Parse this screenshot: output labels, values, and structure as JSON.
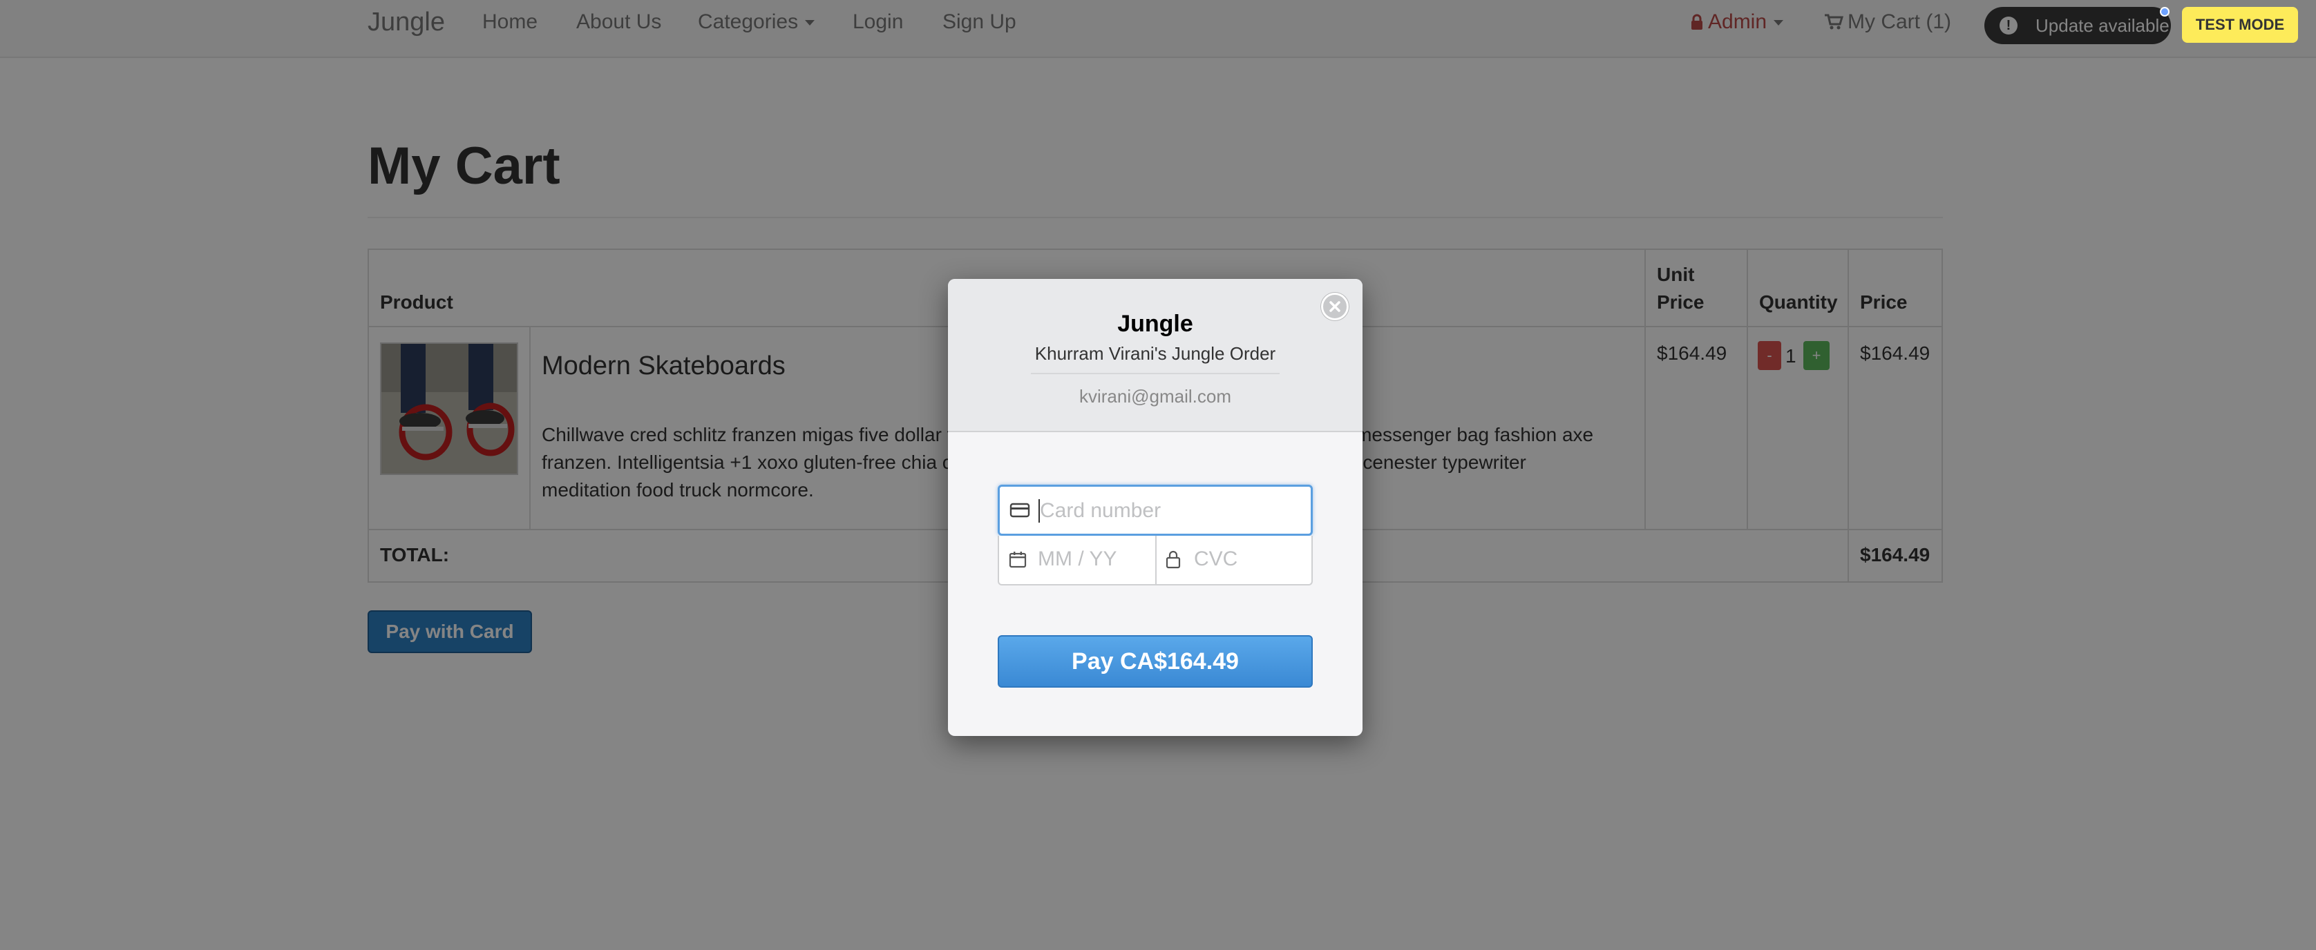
{
  "navbar": {
    "brand": "Jungle",
    "links": [
      "Home",
      "About Us",
      "Categories",
      "Login",
      "Sign Up"
    ],
    "admin_label": "Admin",
    "cart_label": "My Cart (1)",
    "update_label": "Update available",
    "test_mode": "TEST MODE"
  },
  "page": {
    "title": "My Cart"
  },
  "table": {
    "headers": [
      "Product",
      "Unit Price",
      "Quantity",
      "Price"
    ],
    "header_unit_line1": "Unit",
    "header_unit_line2": "Price",
    "row": {
      "name": "Modern Skateboards",
      "description": "Chillwave cred schlitz franzen migas five dollar toast. Tumblr cold-pressed before they sold out messenger bag fashion axe franzen. Intelligentsia +1 xoxo gluten-free chia chambray normcore tote bag hashtag whatever scenester typewriter meditation food truck normcore.",
      "unit_price": "$164.49",
      "quantity_minus": "-",
      "quantity": "1",
      "quantity_plus": "+",
      "price": "$164.49"
    },
    "total_label": "TOTAL:",
    "total_value": "$164.49"
  },
  "pay_with_card": "Pay with Card",
  "checkout_modal": {
    "title": "Jungle",
    "subtitle": "Khurram Virani's Jungle Order",
    "email": "kvirani@gmail.com",
    "card_placeholder": "Card number",
    "expiry_placeholder": "MM / YY",
    "cvc_placeholder": "CVC",
    "pay_button": "Pay CA$164.49"
  },
  "colors": {
    "accent_blue": "#3a89d4",
    "danger": "#d9534f",
    "success": "#5cb85c",
    "test_mode_bg": "#fdeb5a"
  }
}
